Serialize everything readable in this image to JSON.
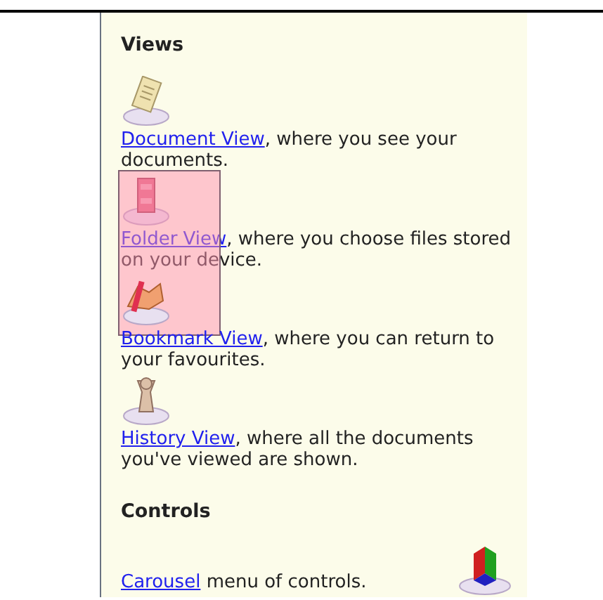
{
  "sections": [
    {
      "heading": "Views",
      "items": [
        {
          "kind": "document",
          "link": "Document View",
          "text": ", where you see your documents.",
          "highlighted": false
        },
        {
          "kind": "folder",
          "link": "Folder View",
          "text": ", where you choose files stored on your device.",
          "highlighted": true
        },
        {
          "kind": "bookmark",
          "link": "Bookmark View",
          "text": ", where you can return to your favourites.",
          "highlighted": false
        },
        {
          "kind": "history",
          "link": "History View",
          "text": ", where all the documents you've viewed are shown.",
          "highlighted": false
        }
      ]
    },
    {
      "heading": "Controls",
      "items": [
        {
          "kind": "carousel",
          "link": "Carousel",
          "text": " menu of controls.",
          "highlighted": false
        }
      ]
    }
  ]
}
